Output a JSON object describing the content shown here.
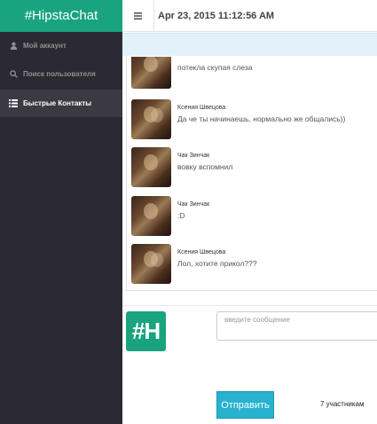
{
  "app": {
    "brand": "#HipstaChat",
    "logo_text": "#H",
    "colors": {
      "brand": "#1aa37f",
      "sidebar": "#2b2a33",
      "accent": "#27b2d0",
      "info": "#e3f1fa"
    }
  },
  "sidebar": {
    "items": [
      {
        "label": "Мой аккаунт",
        "icon": "user-icon"
      },
      {
        "label": "Поиск пользователя",
        "icon": "search-icon"
      },
      {
        "label": "Быстрые Контакты",
        "icon": "list-icon",
        "active": true
      }
    ]
  },
  "topbar": {
    "menu_icon": "hamburger-icon",
    "datetime": "Apr 23, 2015 11:12:56 AM"
  },
  "messages": [
    {
      "name": "",
      "text": "потекла скупая слеза"
    },
    {
      "name": "Ксения Швецова",
      "text": "Да че ты начинаешь, нормально же общались))"
    },
    {
      "name": "Чак Зинчак",
      "text": "вовку вспомнил"
    },
    {
      "name": "Чак Зинчак",
      "text": ":D"
    },
    {
      "name": "Ксения Швецова",
      "text": "Лол, хотите прикол???"
    }
  ],
  "composer": {
    "placeholder": "введите сообщение",
    "send_label": "Отправить",
    "participants": "7 участникам"
  }
}
